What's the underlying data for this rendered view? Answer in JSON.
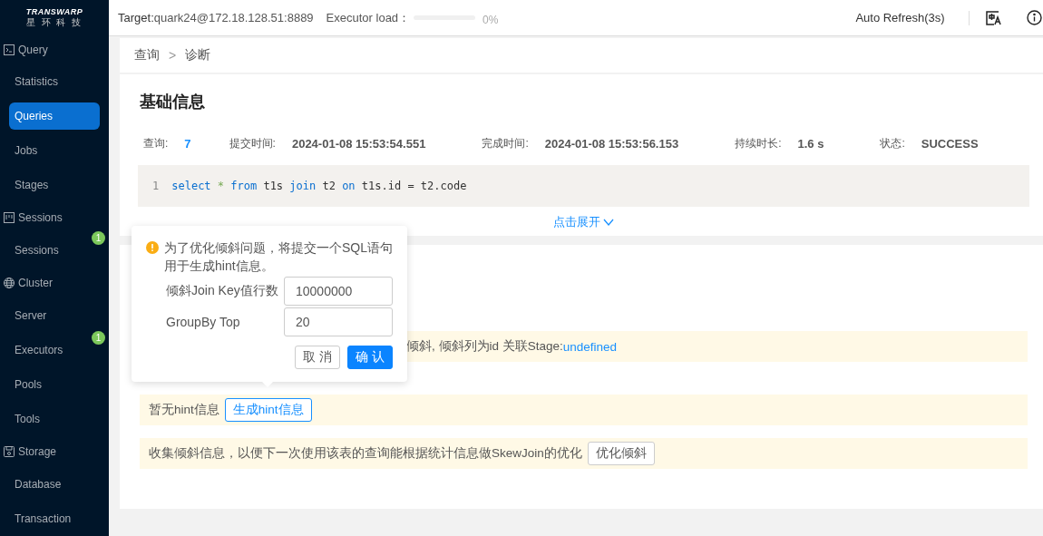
{
  "sidebar": {
    "logo": {
      "name": "TRANSWARP",
      "subtitle": "星 环 科 技"
    },
    "groups": [
      {
        "label": "Query",
        "items": [
          {
            "label": "Statistics",
            "selected": false
          },
          {
            "label": "Queries",
            "selected": true
          },
          {
            "label": "Jobs",
            "selected": false
          },
          {
            "label": "Stages",
            "selected": false
          }
        ]
      },
      {
        "label": "Sessions",
        "items": [
          {
            "label": "Sessions",
            "selected": false,
            "badge": "1"
          }
        ]
      },
      {
        "label": "Cluster",
        "items": [
          {
            "label": "Server",
            "selected": false
          },
          {
            "label": "Executors",
            "selected": false,
            "badge": "1"
          },
          {
            "label": "Pools",
            "selected": false
          },
          {
            "label": "Tools",
            "selected": false
          }
        ]
      },
      {
        "label": "Storage",
        "items": [
          {
            "label": "Database",
            "selected": false
          },
          {
            "label": "Transaction",
            "selected": false
          }
        ]
      }
    ]
  },
  "header": {
    "target_label": "Target:",
    "target_value": "quark24@172.18.128.51:8889",
    "load_label": "Executor load：",
    "load": {
      "level": 0,
      "reading": "0%"
    },
    "auto_refresh": "Auto Refresh(3s)"
  },
  "breadcrumb": [
    "查询",
    "诊断"
  ],
  "breadcrumb_separator": ">",
  "info": {
    "title": "基础信息",
    "fields": [
      {
        "label": "查询:",
        "value": "7",
        "kind": "link"
      },
      {
        "label": "提交时间:",
        "value": "2024-01-08 15:53:54.551",
        "kind": "text"
      },
      {
        "label": "完成时间:",
        "value": "2024-01-08 15:53:56.153",
        "kind": "text"
      },
      {
        "label": "持续时长:",
        "value": "1.6 s",
        "kind": "text"
      },
      {
        "label": "状态:",
        "value": "SUCCESS",
        "kind": "text"
      }
    ],
    "code": {
      "line": "1",
      "tokens": [
        {
          "text": "select",
          "kind": "keyword"
        },
        {
          "text": " * ",
          "kind": "operator"
        },
        {
          "text": "from",
          "kind": "keyword"
        },
        {
          "text": " t1s ",
          "kind": "plain"
        },
        {
          "text": "join",
          "kind": "keyword"
        },
        {
          "text": " t2 ",
          "kind": "plain"
        },
        {
          "text": "on",
          "kind": "keyword"
        },
        {
          "text": " t1s.id = t2.code",
          "kind": "plain"
        }
      ]
    },
    "expand": "点击展开"
  },
  "diagnosis": {
    "skew_text": "倾斜, 倾斜列为id   关联Stage:",
    "skew_link": "undefined",
    "hint_text": "暂无hint信息",
    "hint_button": "生成hint信息",
    "collect_text": "收集倾斜信息，以便下一次使用该表的查询能根据统计信息做SkewJoin的优化",
    "collect_button": "优化倾斜"
  },
  "popover": {
    "message": "为了优化倾斜问题，将提交一个SQL语句用于生成hint信息。",
    "fields": [
      {
        "label": "倾斜Join Key值行数",
        "value": "10000000"
      },
      {
        "label": "GroupBy Top",
        "value": "20"
      }
    ],
    "buttons": [
      {
        "label": "取 消",
        "kind": "default"
      },
      {
        "label": "确 认",
        "kind": "primary"
      }
    ]
  }
}
